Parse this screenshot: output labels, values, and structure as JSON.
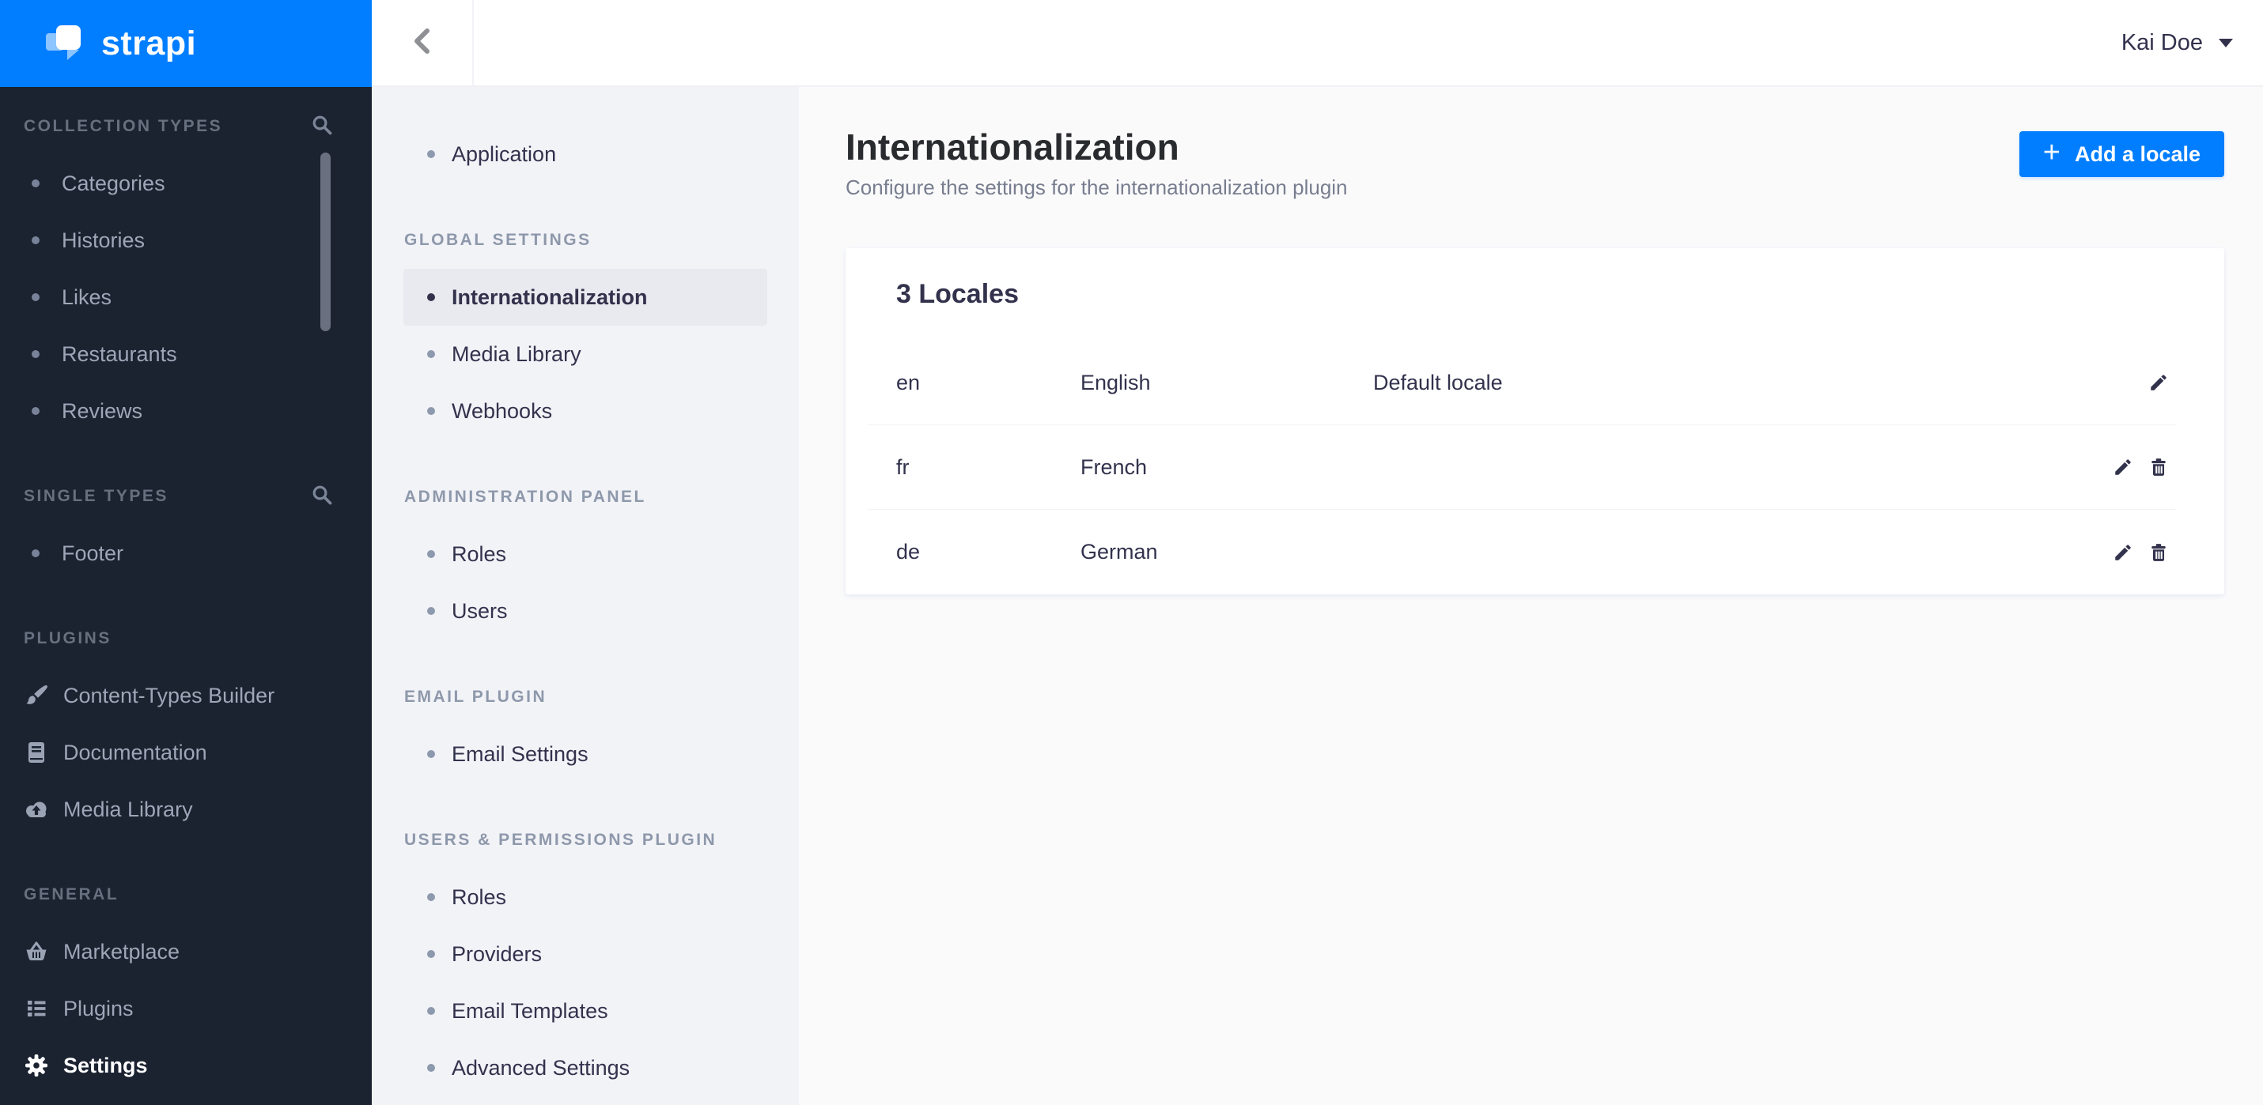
{
  "colors": {
    "accent_blue": "#007eff",
    "sidebar_bg": "#1b2230"
  },
  "topbar": {
    "logo_text": "strapi",
    "user_name": "Kai Doe"
  },
  "left_sidebar": {
    "sections": [
      {
        "label": "COLLECTION TYPES",
        "items": [
          "Categories",
          "Histories",
          "Likes",
          "Restaurants",
          "Reviews"
        ]
      },
      {
        "label": "SINGLE TYPES",
        "items": [
          "Footer"
        ]
      },
      {
        "label": "PLUGINS",
        "items": [
          "Content-Types Builder",
          "Documentation",
          "Media Library"
        ]
      },
      {
        "label": "GENERAL",
        "items": [
          "Marketplace",
          "Plugins",
          "Settings"
        ]
      }
    ]
  },
  "settings_menu": {
    "application_label": "Application",
    "active_item": "Internationalization",
    "groups": [
      {
        "label": "GLOBAL SETTINGS",
        "items": [
          "Internationalization",
          "Media Library",
          "Webhooks"
        ]
      },
      {
        "label": "ADMINISTRATION PANEL",
        "items": [
          "Roles",
          "Users"
        ]
      },
      {
        "label": "EMAIL PLUGIN",
        "items": [
          "Email Settings"
        ]
      },
      {
        "label": "USERS & PERMISSIONS PLUGIN",
        "items": [
          "Roles",
          "Providers",
          "Email Templates",
          "Advanced Settings"
        ]
      }
    ]
  },
  "main": {
    "title": "Internationalization",
    "subtitle": "Configure the settings for the internationalization plugin",
    "add_button_label": "Add a locale",
    "plus_sign": "+",
    "card": {
      "title": "3 Locales",
      "rows": [
        {
          "code": "en",
          "name": "English",
          "note": "Default locale"
        },
        {
          "code": "fr",
          "name": "French",
          "note": ""
        },
        {
          "code": "de",
          "name": "German",
          "note": ""
        }
      ]
    }
  }
}
